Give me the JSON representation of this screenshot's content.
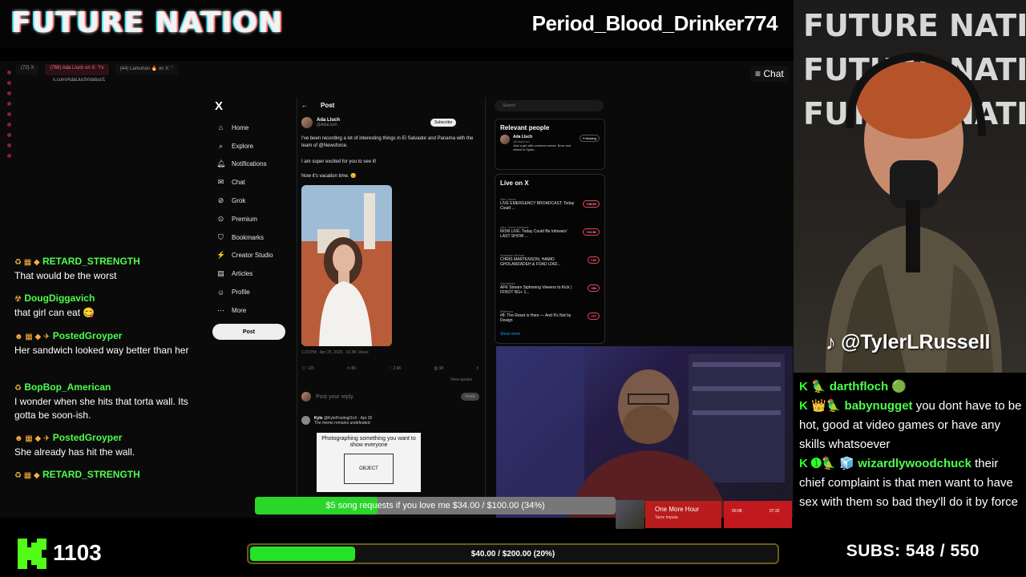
{
  "brand": "FUTURE NATION",
  "streamer_name": "Period_Blood_Drinker774",
  "browser": {
    "tabs": [
      "(72) X",
      "(788) Ada Lluch on X: \"I'v",
      "(44) Lamurian 🔥 on X: \""
    ],
    "url": "x.com/AdaLluch/status/1",
    "chat_button": "Chat"
  },
  "x_nav": {
    "logo": "X",
    "items": [
      {
        "label": "Home",
        "icon": "home-icon",
        "glyph": "⌂"
      },
      {
        "label": "Explore",
        "icon": "search-icon",
        "glyph": "⌕"
      },
      {
        "label": "Notifications",
        "icon": "bell-icon",
        "glyph": "🔔︎"
      },
      {
        "label": "Chat",
        "icon": "chat-icon",
        "glyph": "✉"
      },
      {
        "label": "Grok",
        "icon": "grok-icon",
        "glyph": "⊘"
      },
      {
        "label": "Premium",
        "icon": "premium-icon",
        "glyph": "⊙"
      },
      {
        "label": "Bookmarks",
        "icon": "bookmark-icon",
        "glyph": "⛉"
      },
      {
        "label": "Creator Studio",
        "icon": "creator-icon",
        "glyph": "⚡"
      },
      {
        "label": "Articles",
        "icon": "articles-icon",
        "glyph": "▤"
      },
      {
        "label": "Profile",
        "icon": "profile-icon",
        "glyph": "☺"
      },
      {
        "label": "More",
        "icon": "more-icon",
        "glyph": "⋯"
      }
    ],
    "post_button": "Post"
  },
  "post": {
    "header": "Post",
    "author": "Ada Lluch",
    "handle": "@AdaLluch",
    "subscribe": "Subscribe",
    "text1": "I've been recording a lot of interesting things in El Salvador and Panama with the team of @Newsforce.",
    "text2": "I am super excited for you to see it!",
    "text3": "Now it's vacation time. 😊",
    "meta": "1:23 PM · Apr 25, 2026 · 52.8K Views",
    "actions": [
      "125",
      "80",
      "2.6K",
      "98",
      "↥"
    ],
    "reply_placeholder": "Post your reply",
    "reply_button": "Reply",
    "reply_author": "Kyle",
    "reply_handle": "@KylePostingOnX · Apr 26",
    "reply_text": "The meme remains undefeated",
    "meme_caption": "Photographing something you want to show everyone",
    "meme_object": "OBJECT",
    "view_quotes": "View quotes"
  },
  "sidebar_right": {
    "search_placeholder": "Search",
    "relevant_title": "Relevant people",
    "relevant_name": "Ada Lluch",
    "relevant_handle": "@AdaLluch",
    "relevant_bio": "Just a girl with common sense. Born and raised in Spain.",
    "following": "Following",
    "live_title": "Live on X",
    "live": [
      {
        "host": "Alex Jones",
        "title": "LIVE EMERGENCY BROADCAST: Today Could ...",
        "count": "+98.2K"
      },
      {
        "host": "Alex Jones Network",
        "title": "NOW LIVE: Today Could Be Infowars' LAST SHOW ...",
        "count": "+10.3K"
      },
      {
        "host": "Sulaiman Ahmed",
        "title": "CHRIS MARTENSON, HAMID GHOLAMZADEH & FOAD IZAD...",
        "count": "+1K"
      },
      {
        "host": "Gamahold",
        "title": "AFK Stream Siphoning Viewers to Kick | FFBOT NG+ 1...",
        "count": "+84"
      },
      {
        "host": "Rebecca",
        "title": "#8: The Reset is Here — And It's Not by Design",
        "count": "+77"
      }
    ],
    "show_more": "Show more"
  },
  "left_chat": [
    {
      "badges": "♻ ▦ ◆",
      "user": "RETARD_STRENGTH",
      "text": "That would be the worst"
    },
    {
      "badges": "☢",
      "user": "DougDiggavich",
      "text": "that girl can eat 😋"
    },
    {
      "badges": "☻ ▦ ◆ ✈",
      "user": "PostedGroyper",
      "text": "Her sandwich looked way better than her"
    },
    {
      "badges": "♻",
      "user": "BopBop_American",
      "text": "I wonder when she hits that torta wall. Its gotta be soon-ish."
    },
    {
      "badges": "☻ ▦ ◆ ✈",
      "user": "PostedGroyper",
      "text": "She already has hit the wall."
    },
    {
      "badges": "♻ ▦ ◆",
      "user": "RETARD_STRENGTH",
      "text": ""
    }
  ],
  "tiktok_handle": "@TylerLRussell",
  "right_chat": [
    {
      "badges": "K 🦜",
      "user": "darthfloch",
      "text": "🟢"
    },
    {
      "badges": "K 👑🦜",
      "user": "babynugget",
      "text": "you dont have to be hot, good at video games or have any skills whatsoever"
    },
    {
      "badges": "K ➊🦜 🧊",
      "user": "wizardlywoodchuck",
      "text": "their chief complaint is that men want to have sex with them so bad they'll do it by force"
    }
  ],
  "song_bar": {
    "text": "$5 song requests if you love me $34.00 / $100.00 (34%)",
    "progress": 0.34,
    "now_playing_title": "One More Hour",
    "now_playing_artist": "Tame Impala",
    "time_elapsed": "00:08",
    "time_total": "07:32"
  },
  "kick_count": "1103",
  "goal": {
    "text": "$40.00 / $200.00 (20%)",
    "progress": 0.2
  },
  "subs": "SUBS:  548 / 550",
  "colors": {
    "kick_green": "#53fc18",
    "chat_name_green": "#4cff4c",
    "bar_green": "#27e327",
    "song_red": "#b81c1c"
  }
}
